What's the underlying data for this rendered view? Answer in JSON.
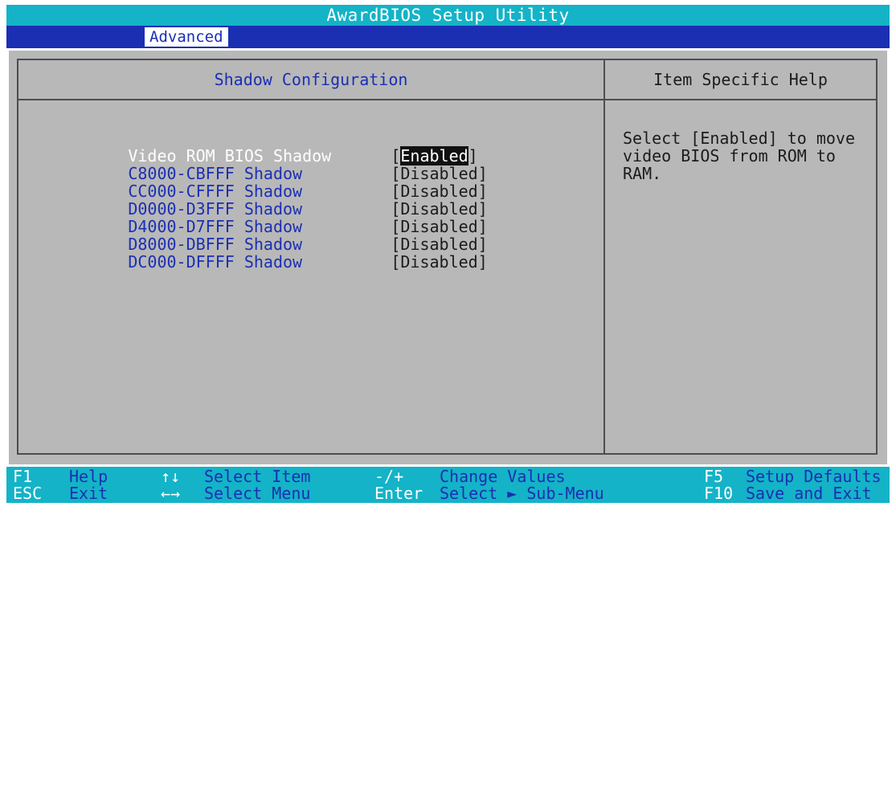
{
  "title": "AwardBIOS Setup Utility",
  "menu": {
    "active_tab": "Advanced"
  },
  "panel": {
    "left_title": "Shadow Configuration",
    "right_title": "Item Specific Help"
  },
  "items": [
    {
      "label": "Video ROM BIOS Shadow",
      "value": "Enabled",
      "selected": true
    },
    {
      "label": "C8000-CBFFF Shadow",
      "value": "Disabled",
      "selected": false
    },
    {
      "label": "CC000-CFFFF Shadow",
      "value": "Disabled",
      "selected": false
    },
    {
      "label": "D0000-D3FFF Shadow",
      "value": "Disabled",
      "selected": false
    },
    {
      "label": "D4000-D7FFF Shadow",
      "value": "Disabled",
      "selected": false
    },
    {
      "label": "D8000-DBFFF Shadow",
      "value": "Disabled",
      "selected": false
    },
    {
      "label": "DC000-DFFFF Shadow",
      "value": "Disabled",
      "selected": false
    }
  ],
  "help": {
    "text": "Select [Enabled] to move\nvideo BIOS from ROM to\nRAM."
  },
  "footer": {
    "keys": [
      {
        "key": "F1",
        "action": "Help"
      },
      {
        "key": "ESC",
        "action": "Exit"
      },
      {
        "key": "↑↓",
        "action": "Select Item"
      },
      {
        "key": "←→",
        "action": "Select Menu"
      },
      {
        "key": "-/+",
        "action": "Change Values"
      },
      {
        "key": "Enter",
        "action": "Select ► Sub-Menu"
      },
      {
        "key": "F5",
        "action": "Setup Defaults"
      },
      {
        "key": "F10",
        "action": "Save and Exit"
      }
    ]
  },
  "colors": {
    "cyan_bar": "#14b3c7",
    "blue": "#1b2fb3",
    "panel_gray": "#b8b8b8",
    "text_white": "#ffffff",
    "text_dark": "#1c1c1c"
  }
}
